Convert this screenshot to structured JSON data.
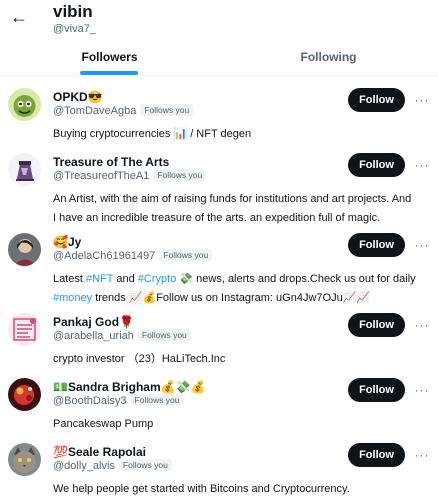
{
  "header": {
    "title": "vibin",
    "handle": "@viva7_",
    "back_icon": "←"
  },
  "tabs": [
    {
      "label": "Followers",
      "active": true
    },
    {
      "label": "Following",
      "active": false
    }
  ],
  "colors": {
    "accent": "#1d9bf0",
    "button_bg": "#0f1419",
    "secondary_text": "#536471"
  },
  "follows_you_label": "Follows you",
  "follow_label": "Follow",
  "more_icon": "···",
  "followers": [
    {
      "name": "OPKD😎",
      "handle": "@TomDaveAgba",
      "bio": [
        "Buying cryptocurrencies 📊 / NFT degen"
      ]
    },
    {
      "name": "Treasure of The Arts",
      "handle": "@TreasureofTheA1",
      "bio": [
        "An Artist, with the aim of raising funds for institutions and art projects. And",
        "I have an incredible treasure of the arts. an expedition full of magic."
      ]
    },
    {
      "name": "🥰Jy",
      "handle": "@AdelaCh61961497",
      "bio_parts": {
        "p1": "Latest ",
        "tag1": "#NFT",
        "p2": " and ",
        "tag2": "#Crypto",
        "p3": " 💸 news, alerts and drops.Check us out for daily",
        "tag3": "#money",
        "p4": " trends 📈💰Follow us on Instagram: uGn4Jw7OJu📈📈"
      }
    },
    {
      "name": "Pankaj God🌹",
      "handle": "@arabella_uriah",
      "bio": [
        "crypto investor （23）HaLiTech.Inc"
      ]
    },
    {
      "name": "💵Sandra Brigham💰💸💰",
      "handle": "@BoothDaisy3",
      "bio": [
        "Pancakeswap Pump"
      ]
    },
    {
      "name": "💯Seale Rapolai",
      "handle": "@dolly_alvis",
      "bio": [
        "We help people get started with Bitcoins and Cryptocurrency."
      ]
    }
  ]
}
